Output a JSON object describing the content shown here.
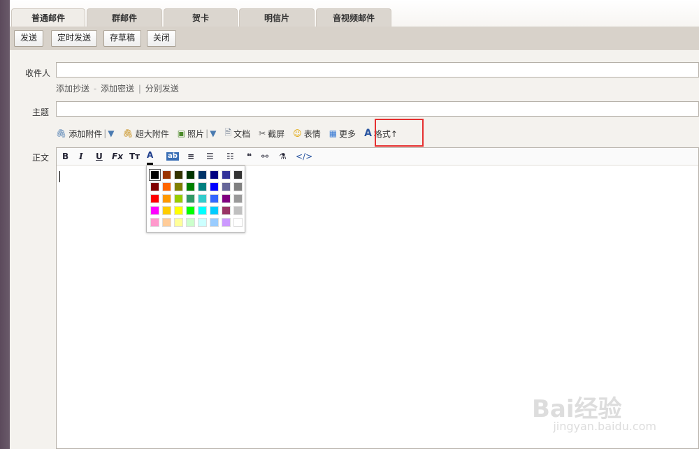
{
  "tabs": [
    {
      "label": "普通邮件",
      "active": true
    },
    {
      "label": "群邮件"
    },
    {
      "label": "贺卡"
    },
    {
      "label": "明信片"
    },
    {
      "label": "音视频邮件"
    }
  ],
  "toolbar": {
    "send": "发送",
    "schedule": "定时发送",
    "save_draft": "存草稿",
    "close": "关闭"
  },
  "form": {
    "recipient_label": "收件人",
    "cc_link": "添加抄送",
    "bcc_link": "添加密送",
    "separate_link": "分别发送",
    "subject_label": "主题",
    "body_label": "正文"
  },
  "attach_bar": {
    "add_attachment": "添加附件",
    "big_attachment": "超大附件",
    "photo": "照片",
    "document": "文档",
    "screenshot": "截屏",
    "emoji": "表情",
    "more": "更多",
    "format": "格式↑"
  },
  "editor_tools": {
    "bold": "B",
    "italic": "I",
    "underline": "U",
    "clear": "Fx",
    "size": "Tт",
    "fontcolor": "A",
    "bgcolor": "ab",
    "align": "≡",
    "list": "☰",
    "indent": "☷",
    "quote": "❝",
    "link": "⚯",
    "paint": "⚗",
    "code": "</>"
  },
  "color_palette": [
    [
      "#000000",
      "#993300",
      "#333300",
      "#003300",
      "#003366",
      "#000080",
      "#333399",
      "#333333"
    ],
    [
      "#800000",
      "#ff6600",
      "#808000",
      "#008000",
      "#008080",
      "#0000ff",
      "#666699",
      "#808080"
    ],
    [
      "#ff0000",
      "#ff9900",
      "#99cc00",
      "#339966",
      "#33cccc",
      "#3366ff",
      "#800080",
      "#999999"
    ],
    [
      "#ff00ff",
      "#ffcc00",
      "#ffff00",
      "#00ff00",
      "#00ffff",
      "#00ccff",
      "#993366",
      "#c0c0c0"
    ],
    [
      "#ff99cc",
      "#ffcc99",
      "#ffff99",
      "#ccffcc",
      "#ccffff",
      "#99ccff",
      "#cc99ff",
      "#ffffff"
    ]
  ],
  "watermark": {
    "brand": "Bai经验",
    "url": "jingyan.baidu.com"
  }
}
